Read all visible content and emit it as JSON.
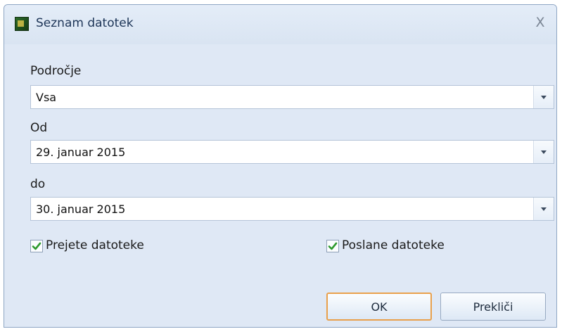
{
  "window": {
    "title": "Seznam datotek",
    "close_glyph": "X",
    "app_icon": "app-icon"
  },
  "form": {
    "area_label": "Področje",
    "area_value": "Vsa",
    "from_label": "Od",
    "from_value": "29. januar 2015",
    "to_label": "do",
    "to_value": "30. januar 2015",
    "received_label": "Prejete datoteke",
    "received_checked": true,
    "sent_label": "Poslane datoteke",
    "sent_checked": true
  },
  "buttons": {
    "ok_label": "OK",
    "cancel_label": "Prekliči"
  },
  "colors": {
    "background": "#dfe8f5",
    "default_button_border": "#e9a04b",
    "checkmark": "#2e9a2e"
  }
}
